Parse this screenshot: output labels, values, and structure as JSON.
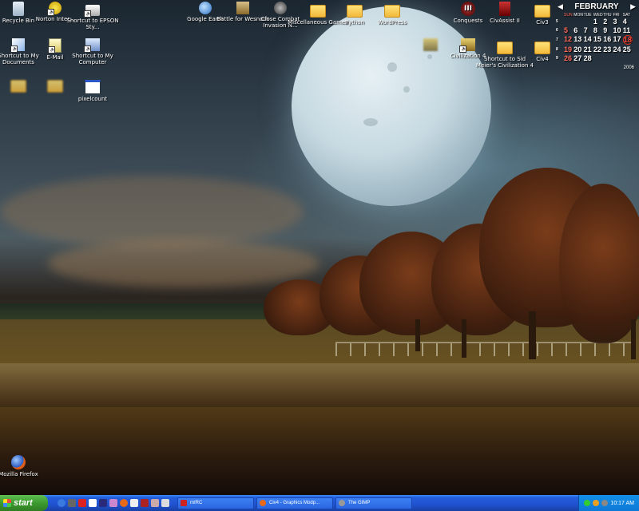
{
  "desktop_icons": {
    "recycle_bin": "Recycle Bin",
    "norton": "Norton Inter...",
    "epson": "Shortcut to EPSON Sty...",
    "google_earth": "Google Earth",
    "wesnoth": "Battle for Wesnoth",
    "close_combat": "Close Combat Invasion N...",
    "misc_games": "Miscellaneous Games",
    "python": "Python",
    "wordpress": "WordPress",
    "conquests": "Conquests",
    "civassist": "CivAssist II",
    "civ3": "Civ3",
    "my_documents": "Shortcut to My Documents",
    "email": "E-Mail",
    "my_computer": "Shortcut to My Computer",
    "civ4": "Civilization 4",
    "sid_meier_civ4": "Shortcut to Sid Meier's Civilization 4",
    "civ4_folder": "Civ4",
    "pixelcount": "pixelcount",
    "firefox": "Mozilla Firefox"
  },
  "calendar": {
    "month": "FEBRUARY",
    "year": "2006",
    "weekday_headers": [
      "SUN",
      "MON",
      "TUE",
      "WED",
      "THU",
      "FRI",
      "SAT"
    ],
    "weeks": [
      {
        "wk": "5",
        "days": [
          "",
          "",
          "",
          "1",
          "2",
          "3",
          "4"
        ]
      },
      {
        "wk": "6",
        "days": [
          "5",
          "6",
          "7",
          "8",
          "9",
          "10",
          "11"
        ]
      },
      {
        "wk": "7",
        "days": [
          "12",
          "13",
          "14",
          "15",
          "16",
          "17",
          "18"
        ]
      },
      {
        "wk": "8",
        "days": [
          "19",
          "20",
          "21",
          "22",
          "23",
          "24",
          "25"
        ]
      },
      {
        "wk": "9",
        "days": [
          "26",
          "27",
          "28",
          "",
          "",
          "",
          ""
        ]
      }
    ],
    "today": "18"
  },
  "taskbar": {
    "start_label": "start",
    "tasks": [
      "mIRC",
      "Civ4 - Graphics Modp...",
      "The GIMP"
    ],
    "clock": "10:17 AM"
  }
}
